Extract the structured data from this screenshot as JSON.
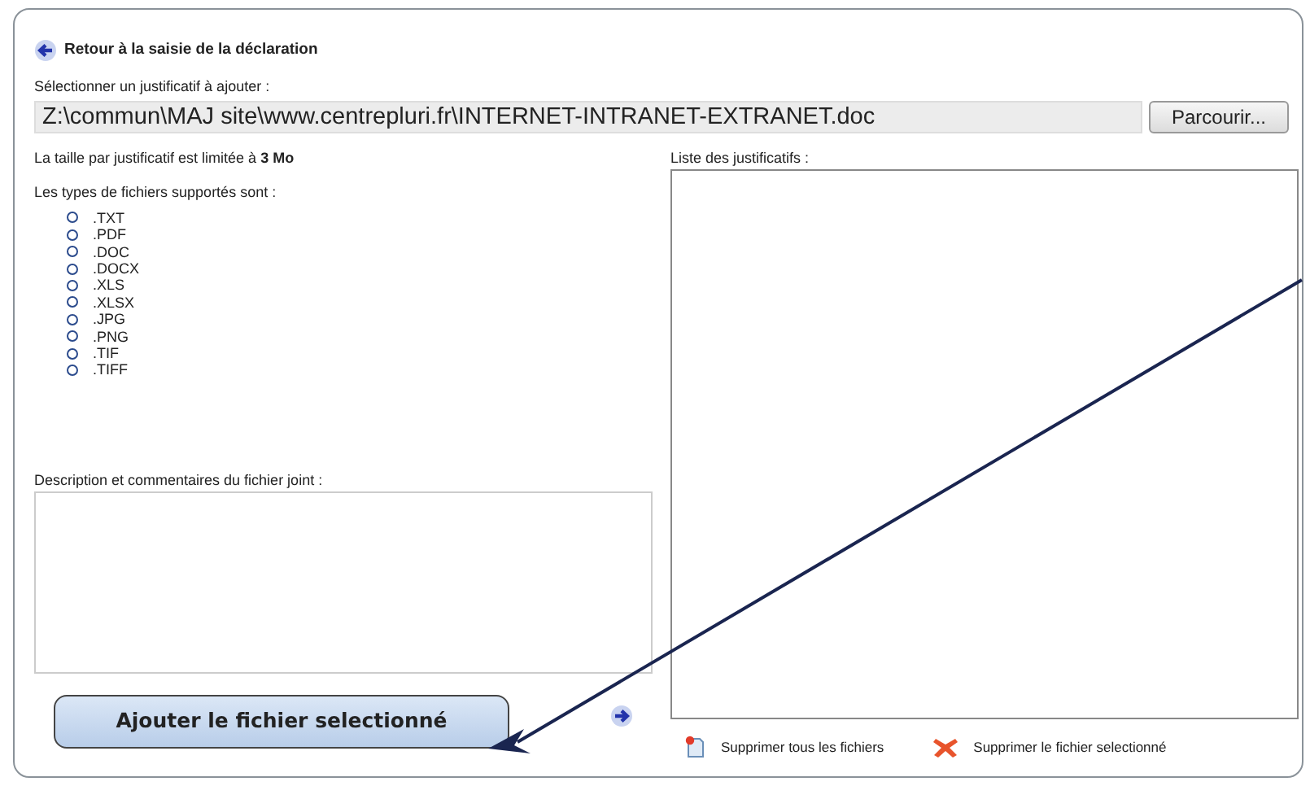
{
  "back_link": {
    "label": "Retour à la saisie de la déclaration"
  },
  "file_select": {
    "label": "Sélectionner un justificatif à ajouter :",
    "value": "Z:\\commun\\MAJ site\\www.centrepluri.fr\\INTERNET-INTRANET-EXTRANET.doc",
    "browse_button": "Parcourir..."
  },
  "size_note": "La taille par justificatif est limitée à **3 Mo**",
  "file_types": {
    "label": "Les types de fichiers supportés sont :",
    "items": [
      ".TXT",
      ".PDF",
      ".DOC",
      ".DOCX",
      ".XLS",
      ".XLSX",
      ".JPG",
      ".PNG",
      ".TIF",
      ".TIFF"
    ]
  },
  "description": {
    "label": "Description et commentaires du fichier joint :"
  },
  "attachments_list": {
    "label": "Liste des justificatifs :"
  },
  "add_button": {
    "label": "Ajouter le fichier selectionné"
  },
  "actions": [
    {
      "kind": "delete-all",
      "label": "Supprimer tous les fichiers"
    },
    {
      "kind": "delete-one",
      "label": "Supprimer le fichier selectionné"
    }
  ]
}
